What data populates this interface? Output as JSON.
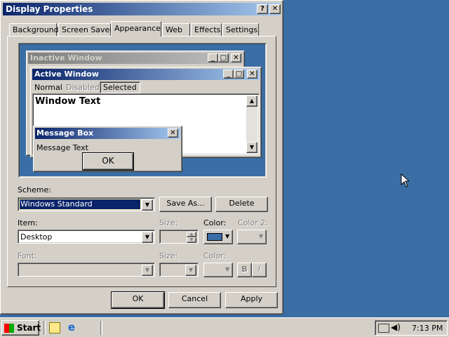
{
  "window": {
    "title": "Display Properties",
    "help_btn": "?",
    "close_btn": "✕"
  },
  "tabs": [
    "Background",
    "Screen Saver",
    "Appearance",
    "Web",
    "Effects",
    "Settings"
  ],
  "preview": {
    "inactive_title": "Inactive Window",
    "active_title": "Active Window",
    "menu": [
      "Normal",
      "Disabled",
      "Selected"
    ],
    "window_text": "Window Text",
    "msgbox_title": "Message Box",
    "msgbox_text": "Message Text",
    "msgbox_ok": "OK"
  },
  "scheme": {
    "label": "Scheme:",
    "value": "Windows Standard",
    "save_as": "Save As...",
    "delete": "Delete"
  },
  "item": {
    "label": "Item:",
    "value": "Desktop",
    "size_label": "Size:",
    "color_label": "Color:",
    "color2_label": "Color 2:",
    "color": "#3a6ea5"
  },
  "font": {
    "label": "Font:",
    "size_label": "Size:",
    "color_label": "Color:",
    "bold": "B",
    "italic": "I"
  },
  "buttons": {
    "ok": "OK",
    "cancel": "Cancel",
    "apply": "Apply"
  },
  "taskbar": {
    "start": "Start",
    "clock": "7:13 PM"
  },
  "colors": {
    "desktop": "#3a6ea5",
    "title_active": "#0a246a",
    "selection": "#0a246a"
  }
}
